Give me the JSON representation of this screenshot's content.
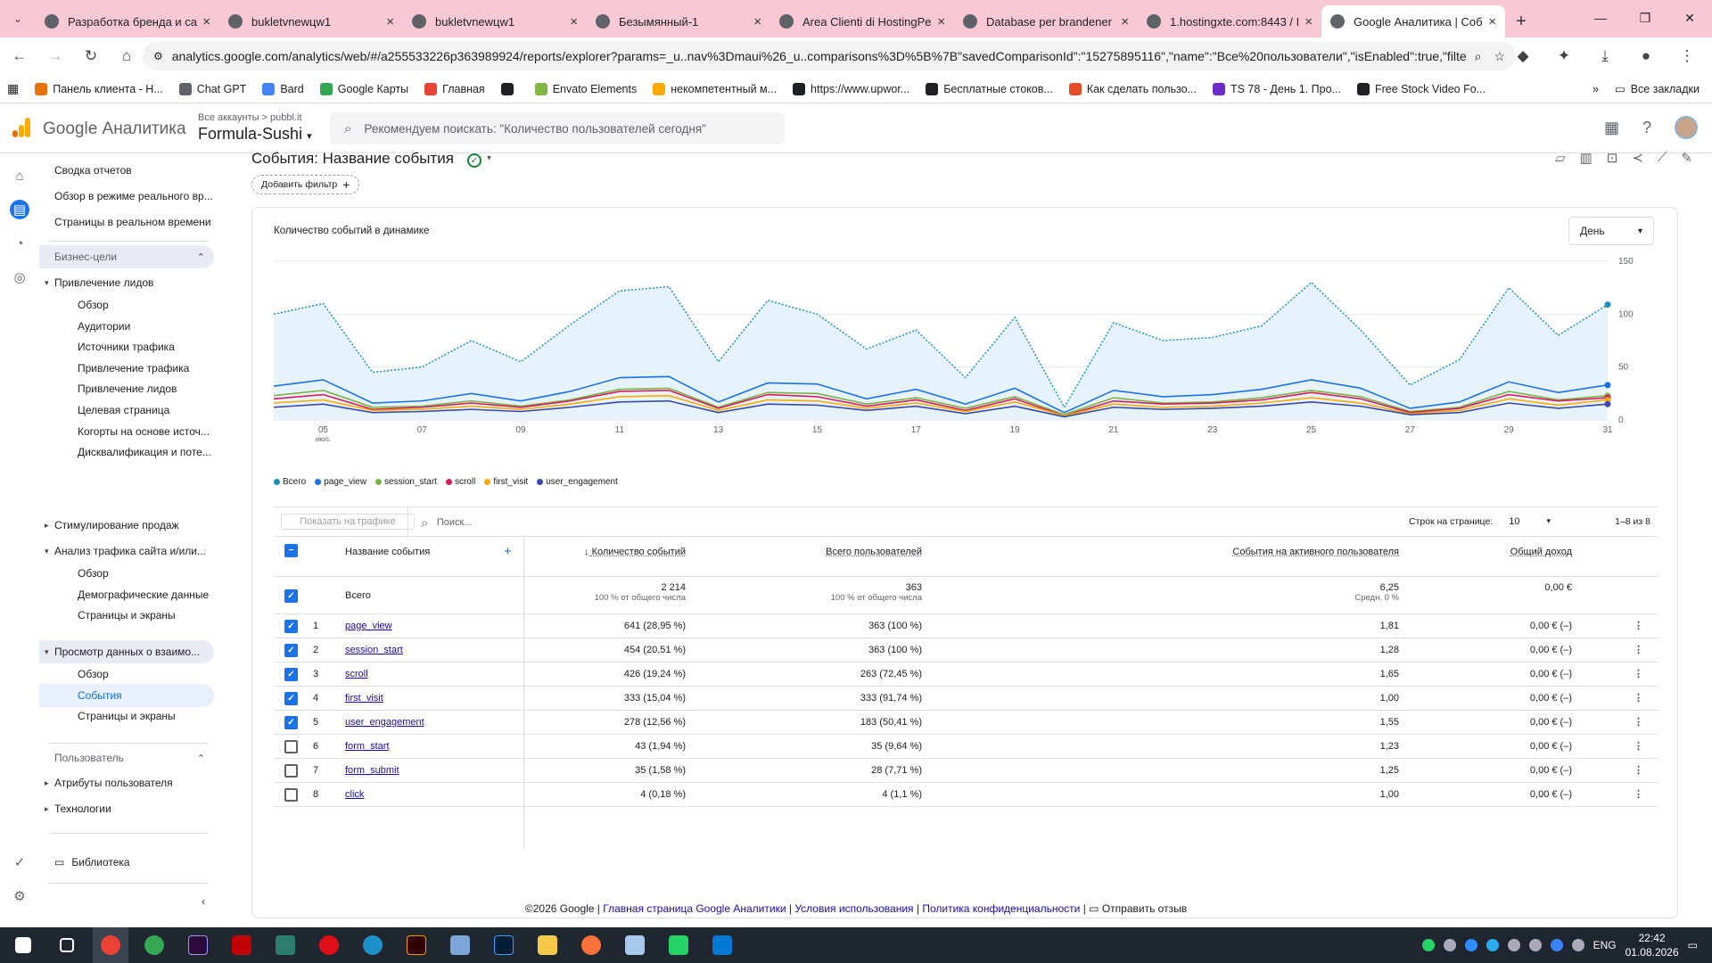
{
  "browser": {
    "tabs": [
      {
        "title": "Разработка бренда и сай",
        "active": false
      },
      {
        "title": "bukletvnewцw1",
        "active": false
      },
      {
        "title": "bukletvnewцw1",
        "active": false
      },
      {
        "title": "Безымянный-1",
        "active": false
      },
      {
        "title": "Area Clienti di HostingPe",
        "active": false
      },
      {
        "title": "Database per brandener",
        "active": false
      },
      {
        "title": "1.hostingxte.com:8443 / I",
        "active": false
      },
      {
        "title": "Google Аналитика | Собы",
        "active": true
      }
    ],
    "url": "analytics.google.com/analytics/web/#/a255533226p363989924/reports/explorer?params=_u..nav%3Dmaui%26_u..comparisons%3D%5B%7B\"savedComparisonId\":\"15275895116\",\"name\":\"Все%20пользователи\",\"isEnabled\":true,\"filte...",
    "bookmarks": [
      {
        "label": "Панель клиента - Н...",
        "color": "#e8710a"
      },
      {
        "label": "Chat GPT",
        "color": "#5f6368"
      },
      {
        "label": "Bard",
        "color": "#4285f4"
      },
      {
        "label": "Google Карты",
        "color": "#34a853"
      },
      {
        "label": "Главная",
        "color": "#ea4335"
      },
      {
        "label": "",
        "color": "#202124"
      },
      {
        "label": "Envato Elements",
        "color": "#82b541"
      },
      {
        "label": "некомпетентный м...",
        "color": "#f9ab00"
      },
      {
        "label": "https://www.upwor...",
        "color": "#202124"
      },
      {
        "label": "Бесплатные стоков...",
        "color": "#202124"
      },
      {
        "label": "Как сделать пользо...",
        "color": "#e44d26"
      },
      {
        "label": "TS 78 - День 1. Про...",
        "color": "#6c2dc7"
      },
      {
        "label": "Free Stock Video Fo...",
        "color": "#202124"
      }
    ],
    "all_bookmarks": "Все закладки"
  },
  "ga": {
    "product": "Google Аналитика",
    "account_path": "Все аккаунты > pubbl.it",
    "property": "Formula-Sushi",
    "search_placeholder": "Рекомендуем поискать: \"Количество пользователей сегодня\""
  },
  "nav": {
    "items": [
      {
        "label": "Сводка отчетов",
        "level": 0
      },
      {
        "label": "Обзор в режиме реального вр...",
        "level": 0
      },
      {
        "label": "Страницы в реальном времени",
        "level": 0
      }
    ],
    "section1": "Бизнес-цели",
    "group1": "Привлечение лидов",
    "group1_items": [
      "Обзор",
      "Аудитории",
      "Источники трафика",
      "Привлечение трафика",
      "Привлечение лидов",
      "Целевая страница",
      "Когорты на основе источ...",
      "Дисквалификация и поте..."
    ],
    "group2": "Стимулирование продаж",
    "group3": "Анализ трафика сайта и/или...",
    "group3_items": [
      "Обзор",
      "Демографические данные",
      "Страницы и экраны"
    ],
    "group4": "Просмотр данных о взаимо...",
    "group4_items": [
      "Обзор",
      "События",
      "Страницы и экраны"
    ],
    "section2": "Пользователь",
    "group5": "Атрибуты пользователя",
    "group6": "Технологии",
    "library": "Библиотека"
  },
  "page": {
    "title": "События: Название события",
    "add_filter": "Добавить фильтр"
  },
  "chart_card": {
    "title": "Количество событий в динамике",
    "granularity": "День"
  },
  "chart_data": {
    "type": "line",
    "x": [
      4,
      5,
      6,
      7,
      8,
      9,
      10,
      11,
      12,
      13,
      14,
      15,
      16,
      17,
      18,
      19,
      20,
      21,
      22,
      23,
      24,
      25,
      26,
      27,
      28,
      29,
      30,
      31
    ],
    "x_tick_labels": [
      "05",
      "07",
      "09",
      "11",
      "13",
      "15",
      "17",
      "19",
      "21",
      "23",
      "25",
      "27",
      "29",
      "31"
    ],
    "x_tick_sublabel": "июл.",
    "y_ticks": [
      "0",
      "50",
      "100",
      "150"
    ],
    "ylim": [
      0,
      150
    ],
    "series": [
      {
        "name": "Всего",
        "color": "#1e8fbf",
        "style": "dotted-area",
        "values": [
          100,
          110,
          45,
          50,
          75,
          55,
          90,
          122,
          126,
          55,
          113,
          100,
          67,
          85,
          40,
          97,
          12,
          92,
          75,
          78,
          89,
          130,
          85,
          33,
          57,
          125,
          80,
          109
        ]
      },
      {
        "name": "page_view",
        "color": "#1a73e8",
        "values": [
          32,
          38,
          16,
          18,
          25,
          18,
          27,
          40,
          41,
          17,
          35,
          34,
          20,
          29,
          15,
          30,
          7,
          28,
          22,
          24,
          29,
          38,
          30,
          11,
          17,
          36,
          26,
          33
        ]
      },
      {
        "name": "session_start",
        "color": "#7cb342",
        "values": [
          23,
          28,
          12,
          13,
          18,
          13,
          19,
          29,
          30,
          12,
          26,
          25,
          15,
          21,
          11,
          22,
          5,
          21,
          16,
          17,
          21,
          28,
          22,
          8,
          12,
          27,
          19,
          23
        ]
      },
      {
        "name": "scroll",
        "color": "#d81b60",
        "values": [
          20,
          24,
          10,
          12,
          16,
          12,
          18,
          27,
          28,
          11,
          24,
          22,
          13,
          19,
          9,
          20,
          4,
          18,
          15,
          16,
          19,
          26,
          20,
          7,
          11,
          24,
          18,
          21
        ]
      },
      {
        "name": "first_visit",
        "color": "#f9ab00",
        "values": [
          16,
          19,
          9,
          10,
          13,
          10,
          15,
          22,
          23,
          9,
          19,
          18,
          11,
          16,
          8,
          17,
          4,
          15,
          12,
          13,
          16,
          21,
          16,
          6,
          9,
          20,
          14,
          19
        ]
      },
      {
        "name": "user_engagement",
        "color": "#3949ab",
        "values": [
          12,
          15,
          7,
          8,
          10,
          8,
          12,
          17,
          18,
          7,
          15,
          14,
          9,
          13,
          6,
          13,
          3,
          12,
          10,
          11,
          13,
          17,
          13,
          5,
          7,
          16,
          11,
          15
        ]
      }
    ]
  },
  "table": {
    "show_on_chart": "Показать на графике",
    "search_placeholder": "Поиск...",
    "rows_per_page_label": "Строк на странице:",
    "rows_per_page": "10",
    "range": "1–8 из 8",
    "col_name": "Название события",
    "col_events": "Количество событий",
    "col_users": "Всего пользователей",
    "col_per_user": "События на активного пользователя",
    "col_revenue": "Общий доход",
    "total": {
      "label": "Всего",
      "events": "2 214",
      "events_sub": "100 % от общего числа",
      "users": "363",
      "users_sub": "100 % от общего числа",
      "per_user": "6,25",
      "per_user_sub": "Средн. 0 %",
      "revenue": "0,00 €"
    },
    "rows": [
      {
        "n": "1",
        "name": "page_view",
        "events": "641 (28,95 %)",
        "users": "363 (100 %)",
        "per_user": "1,81",
        "revenue": "0,00 € (–)",
        "checked": true
      },
      {
        "n": "2",
        "name": "session_start",
        "events": "454 (20,51 %)",
        "users": "363 (100 %)",
        "per_user": "1,28",
        "revenue": "0,00 € (–)",
        "checked": true
      },
      {
        "n": "3",
        "name": "scroll",
        "events": "426 (19,24 %)",
        "users": "263 (72,45 %)",
        "per_user": "1,65",
        "revenue": "0,00 € (–)",
        "checked": true
      },
      {
        "n": "4",
        "name": "first_visit",
        "events": "333 (15,04 %)",
        "users": "333 (91,74 %)",
        "per_user": "1,00",
        "revenue": "0,00 € (–)",
        "checked": true
      },
      {
        "n": "5",
        "name": "user_engagement",
        "events": "278 (12,56 %)",
        "users": "183 (50,41 %)",
        "per_user": "1,55",
        "revenue": "0,00 € (–)",
        "checked": true
      },
      {
        "n": "6",
        "name": "form_start",
        "events": "43 (1,94 %)",
        "users": "35 (9,64 %)",
        "per_user": "1,23",
        "revenue": "0,00 € (–)",
        "checked": false
      },
      {
        "n": "7",
        "name": "form_submit",
        "events": "35 (1,58 %)",
        "users": "28 (7,71 %)",
        "per_user": "1,25",
        "revenue": "0,00 € (–)",
        "checked": false
      },
      {
        "n": "8",
        "name": "click",
        "events": "4 (0,18 %)",
        "users": "4 (1,1 %)",
        "per_user": "1,00",
        "revenue": "0,00 € (–)",
        "checked": false
      }
    ]
  },
  "footer": {
    "copyright": "©2026 Google |",
    "link1": "Главная страница Google Аналитики",
    "link2": "Условия использования",
    "link3": "Политика конфиденциальности",
    "feedback": "Отправить отзыв"
  },
  "taskbar": {
    "lang": "ENG",
    "time": "22:42",
    "date": "01.08.2026"
  }
}
